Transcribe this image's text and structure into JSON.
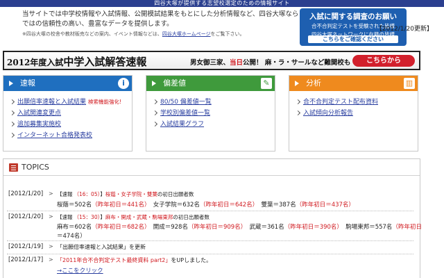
{
  "header": {
    "tagline": "四谷大塚が提供する志望校選定のための情報サイト"
  },
  "intro": {
    "text": "当サイトでは中学校情報や入試情報、公開模試結果をもとにした分析情報など、四谷大塚ならではの信頼性の高い、豊富なデータを提供します。",
    "note_prefix": "※四谷大塚の校舎や教材販売などの案内、イベント情報などは、",
    "note_link": "四谷大塚ホームページ",
    "note_suffix": "をご覧下さい。"
  },
  "survey": {
    "title": "入試に関する調査のお願い",
    "line1": "合不合判定テストを受験された皆様",
    "line2": "四谷大塚ネットワークに在籍の皆様",
    "button": "こちらをご確認ください"
  },
  "banner": {
    "year": "2012年度入試",
    "title": "中学入試解答速報",
    "sub_a": "男女御三家、",
    "sub_red": "当日",
    "sub_b": "公開！",
    "sub_c": "麻・ラ・サールなど難関校も",
    "button": "こちらから"
  },
  "colors": {
    "sokuho": "#1f6fbf",
    "hensachi": "#3f9a3c",
    "bunseki": "#ef8a1e"
  },
  "panels": {
    "sokuho": {
      "title": "速報",
      "icon": "info-icon",
      "items": [
        {
          "label": "出願倍率速報と入試結果",
          "badge": "検索機能強化!"
        },
        {
          "label": "入試関連変更点",
          "badge": ""
        },
        {
          "label": "追加募集実施校",
          "badge": ""
        },
        {
          "label": "インターネット合格発表校",
          "badge": ""
        }
      ]
    },
    "hensachi": {
      "title": "偏差値",
      "icon": "edit-icon",
      "items": [
        {
          "label": "80/50 偏差値一覧"
        },
        {
          "label": "学校別偏差値一覧"
        },
        {
          "label": "入試結果グラフ"
        }
      ]
    },
    "bunseki": {
      "title": "分析",
      "icon": "chart-icon",
      "items": [
        {
          "label": "合不合判定テスト配布資料"
        },
        {
          "label": "入試傾向分析報告"
        }
      ]
    }
  },
  "topics": {
    "title": "TOPICS",
    "updated": "【2012/1/20更新】",
    "rows": [
      {
        "date": "[2012/1/20]",
        "cat": "【速報",
        "time": "（16：05）",
        "bracket": "】",
        "schools": "桜蔭・女子学院・雙葉",
        "suffix": "の初日出願者数",
        "entries": [
          {
            "name": "桜蔭＝502名",
            "prev": "（昨年初日＝441名）"
          },
          {
            "name": "女子学院＝632名",
            "prev": "（昨年初日＝642名）"
          },
          {
            "name": "雙葉＝387名",
            "prev": "（昨年初日＝437名）"
          }
        ]
      },
      {
        "date": "[2012/1/20]",
        "cat": "【速報",
        "time": "（15：30）",
        "bracket": "】",
        "schools": "麻布・開成・武蔵・駒場東邦",
        "suffix": "の初日出願者数",
        "entries": [
          {
            "name": "麻布＝602名",
            "prev": "（昨年初日＝682名）"
          },
          {
            "name": "開成＝928名",
            "prev": "（昨年初日＝909名）"
          },
          {
            "name": "武蔵＝361名",
            "prev": "（昨年初日＝390名）"
          },
          {
            "name": "駒場東邦＝557名",
            "prev": "（昨年初日"
          }
        ],
        "wrap": "＝474名）"
      },
      {
        "date": "[2012/1/19]",
        "msg": "「出願倍率速報と入試結果」を更新"
      },
      {
        "date": "[2012/1/17]",
        "msg_red": "「2011年合不合判定テスト最終資料 part2」",
        "msg_suffix": "をUPしました。",
        "link": "→ここをクリック"
      }
    ]
  }
}
